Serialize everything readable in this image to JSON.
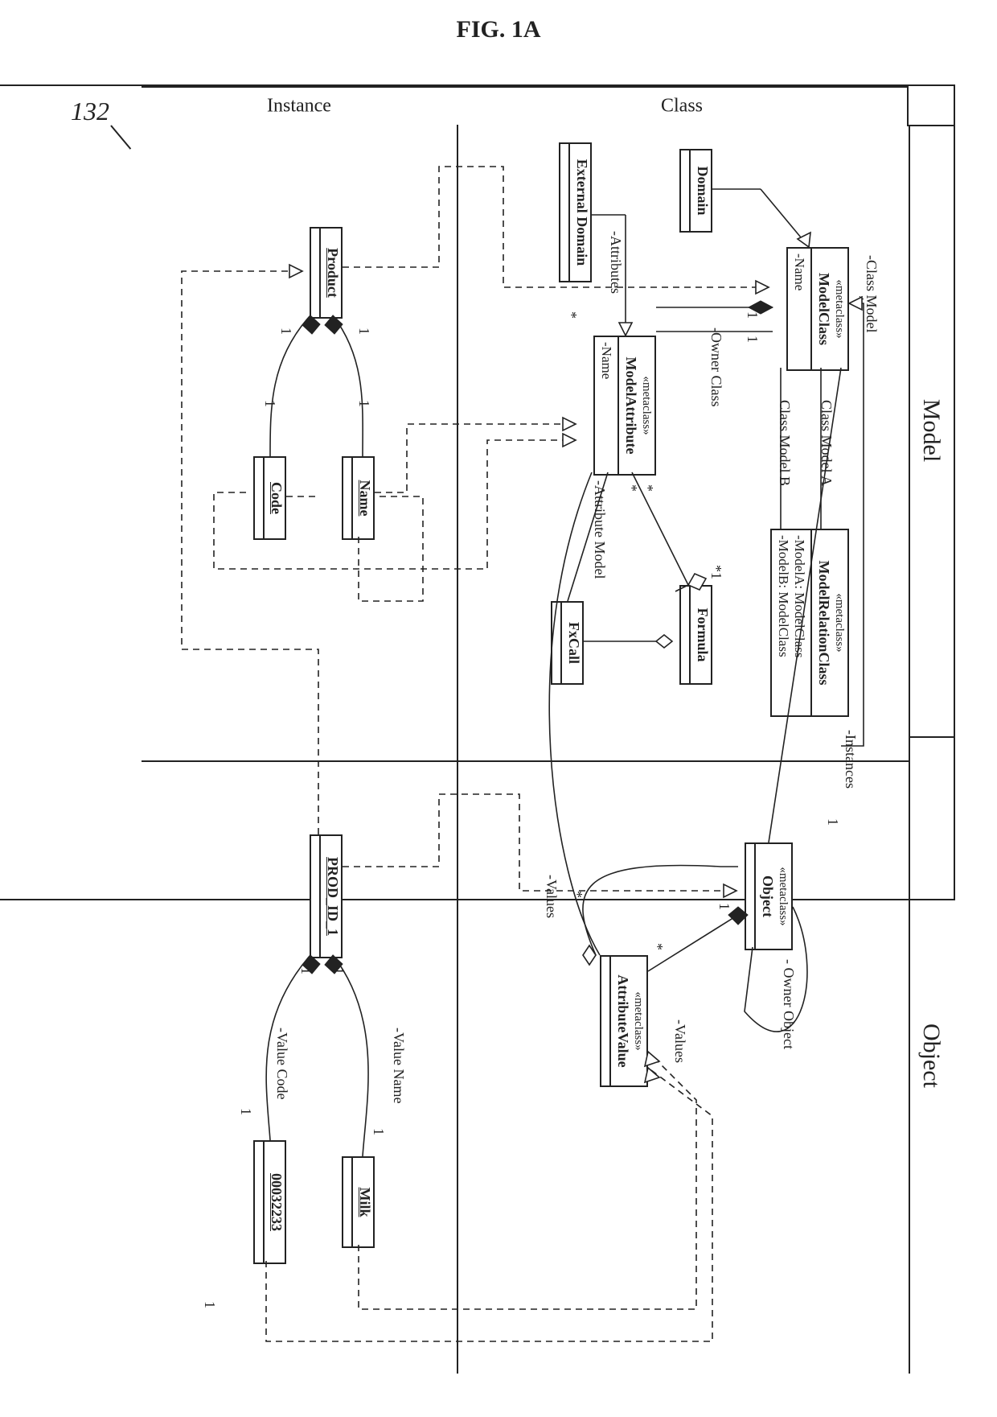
{
  "figure": {
    "title": "FIG. 1A",
    "ref": "132"
  },
  "columns": {
    "model": "Model",
    "object": "Object"
  },
  "rows": {
    "class": "Class",
    "instance": "Instance"
  },
  "classes": {
    "modelClass": {
      "stereo": "«metaclass»",
      "name": "ModelClass",
      "attrs": [
        "-Name"
      ]
    },
    "modelRelationClass": {
      "stereo": "«metaclass»",
      "name": "ModelRelationClass",
      "attrs": [
        "-ModelA: ModelClass",
        "-ModelB: ModelClass"
      ]
    },
    "domain": {
      "name": "Domain"
    },
    "externalDomain": {
      "name": "External Domain"
    },
    "modelAttribute": {
      "stereo": "«metaclass»",
      "name": "ModelAttribute",
      "attrs": [
        "-Name"
      ]
    },
    "formula": {
      "name": "Formula"
    },
    "fxCall": {
      "name": "FxCall"
    },
    "object": {
      "stereo": "«metaclass»",
      "name": "Object"
    },
    "attributeValue": {
      "stereo": "«metaclass»",
      "name": "AttributeValue"
    },
    "product": {
      "name": "Product"
    },
    "nameAttr": {
      "name": "Name"
    },
    "codeAttr": {
      "name": "Code"
    },
    "prodId": {
      "name": "PROD_ID_1"
    },
    "milk": {
      "name": "Milk"
    },
    "code00032233": {
      "name": "00032233"
    }
  },
  "assocLabels": {
    "classModel": "-Class Model",
    "classModelA": "Class Model A",
    "classModelB": "Class Model B",
    "instances": "-Instances",
    "ownerClass": "-Owner Class",
    "attributes": "-Attributes",
    "attributeModel": "-Attribute Model",
    "ownerObject": "- Owner Object",
    "values": "-Values",
    "valuesR": "-Values",
    "valueName": "-Value Name",
    "valueCode": "-Value Code"
  },
  "mult": {
    "one": "1",
    "star": "*",
    "starOne": "*1"
  }
}
